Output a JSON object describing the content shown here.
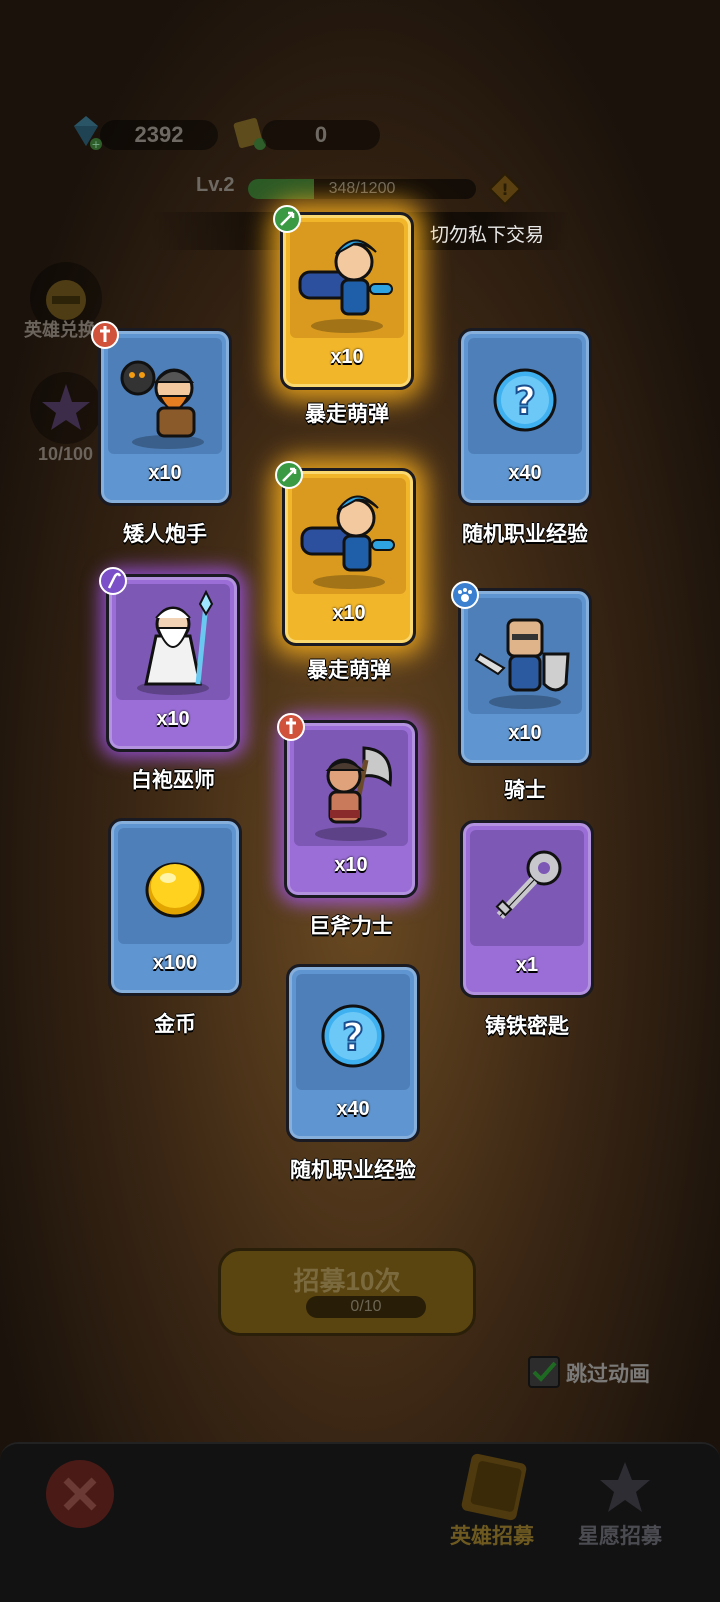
{
  "currency": {
    "gems": "2392",
    "tickets": "0"
  },
  "level": {
    "label": "Lv.2",
    "xp_text": "348/1200",
    "xp_fraction": 0.29
  },
  "notice": "切勿私下交易",
  "side": {
    "hero_exchange": "英雄兑换",
    "star_progress": "10/100"
  },
  "cards": [
    {
      "id": "c1",
      "name": "暴走萌弹",
      "qty": "x10",
      "rarity": "gold",
      "class_icon": "archer-icon"
    },
    {
      "id": "c2",
      "name": "矮人炮手",
      "qty": "x10",
      "rarity": "blue",
      "class_icon": "warrior-icon"
    },
    {
      "id": "c3",
      "name": "随机职业经验",
      "qty": "x40",
      "rarity": "blue",
      "class_icon": ""
    },
    {
      "id": "c4",
      "name": "暴走萌弹",
      "qty": "x10",
      "rarity": "gold",
      "class_icon": "archer-icon"
    },
    {
      "id": "c5",
      "name": "白袍巫师",
      "qty": "x10",
      "rarity": "purple",
      "class_icon": "mage-icon"
    },
    {
      "id": "c6",
      "name": "骑士",
      "qty": "x10",
      "rarity": "blue",
      "class_icon": "paw-icon"
    },
    {
      "id": "c7",
      "name": "巨斧力士",
      "qty": "x10",
      "rarity": "purple",
      "class_icon": "warrior-icon"
    },
    {
      "id": "c8",
      "name": "金币",
      "qty": "x100",
      "rarity": "blue",
      "class_icon": ""
    },
    {
      "id": "c9",
      "name": "铸铁密匙",
      "qty": "x1",
      "rarity": "purple",
      "class_icon": ""
    },
    {
      "id": "c10",
      "name": "随机职业经验",
      "qty": "x40",
      "rarity": "blue",
      "class_icon": ""
    }
  ],
  "recruit": {
    "label": "招募10次",
    "count": "0/10"
  },
  "skip_animation": "跳过动画",
  "tabs": {
    "hero_recruit": "英雄招募",
    "star_recruit": "星愿招募"
  },
  "colors": {
    "gold_card": "#f2b62a",
    "blue_card": "#5f95d0",
    "purple_card": "#9a6ed6"
  }
}
